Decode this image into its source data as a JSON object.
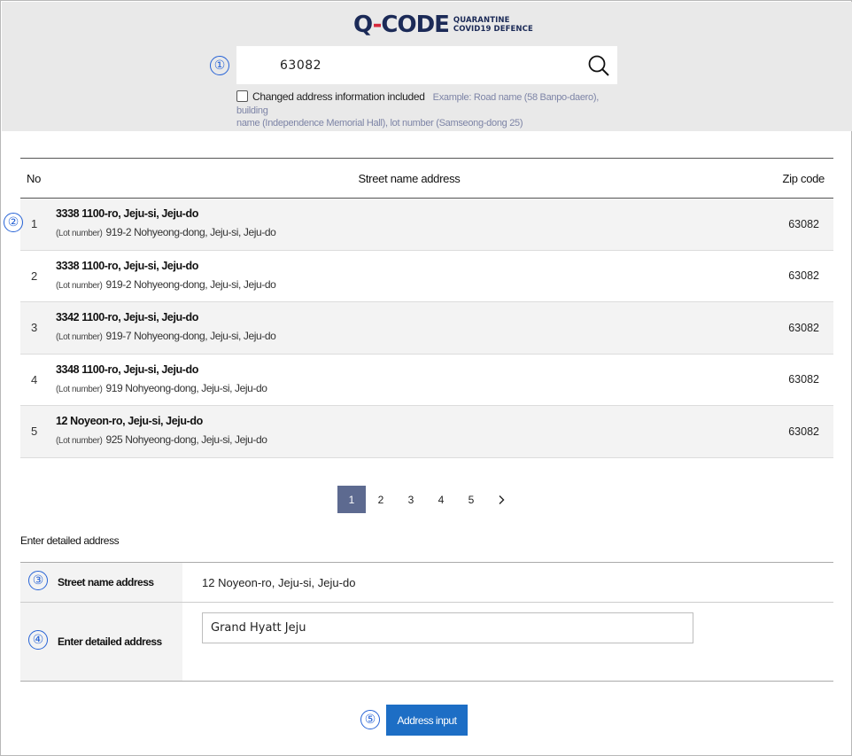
{
  "brand": {
    "logo_q": "Q",
    "logo_dash": "-",
    "logo_code": "CODE",
    "logo_line1": "QUARANTINE",
    "logo_line2": "COVID19 DEFENCE",
    "accent_color": "#1b2a57",
    "accent_red": "#d6283b"
  },
  "markers": [
    "①",
    "②",
    "③",
    "④",
    "⑤"
  ],
  "search": {
    "value": "63082",
    "placeholder": "",
    "button_icon": "search-icon",
    "checkbox_label": "Changed address information included",
    "checkbox_checked": false,
    "example_line1": "Example: Road name (58 Banpo-daero), building",
    "example_line2": "name (Independence Memorial Hall), lot number (Samseong-dong 25)"
  },
  "table": {
    "headers": {
      "no": "No",
      "address": "Street name address",
      "zip": "Zip code"
    },
    "lot_tag": "(Lot number)",
    "rows": [
      {
        "no": "1",
        "street": "3338 1100-ro, Jeju-si, Jeju-do",
        "lot": "919-2 Nohyeong-dong, Jeju-si, Jeju-do",
        "zip": "63082"
      },
      {
        "no": "2",
        "street": "3338 1100-ro, Jeju-si, Jeju-do",
        "lot": "919-2 Nohyeong-dong, Jeju-si, Jeju-do",
        "zip": "63082"
      },
      {
        "no": "3",
        "street": "3342 1100-ro, Jeju-si, Jeju-do",
        "lot": "919-7 Nohyeong-dong, Jeju-si, Jeju-do",
        "zip": "63082"
      },
      {
        "no": "4",
        "street": "3348 1100-ro, Jeju-si, Jeju-do",
        "lot": "919 Nohyeong-dong, Jeju-si, Jeju-do",
        "zip": "63082"
      },
      {
        "no": "5",
        "street": "12 Noyeon-ro, Jeju-si, Jeju-do",
        "lot": "925 Nohyeong-dong, Jeju-si, Jeju-do",
        "zip": "63082"
      }
    ]
  },
  "pagination": {
    "pages": [
      "1",
      "2",
      "3",
      "4",
      "5"
    ],
    "current": "1",
    "next": "›"
  },
  "detail": {
    "section_title": "Enter detailed address",
    "street_label": "Street name address",
    "street_value": "12 Noyeon-ro, Jeju-si, Jeju-do",
    "detail_label": "Enter detailed address",
    "detail_value": "Grand Hyatt Jeju"
  },
  "submit_label": "Address input",
  "colors": {
    "header_bg": "#e9e9e9",
    "marker": "#2763d6",
    "pager_active": "#5d6a90",
    "button": "#1d6ec5"
  }
}
